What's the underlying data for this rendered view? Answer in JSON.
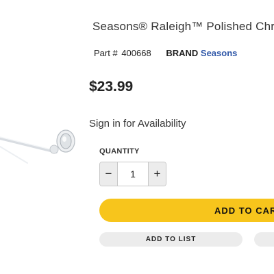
{
  "product": {
    "title": "Seasons® Raleigh™ Polished Chr",
    "part_label": "Part #",
    "part_number": "400668",
    "brand_label": "BRAND",
    "brand_name": "Seasons",
    "price": "$23.99",
    "availability": "Sign in for Availability"
  },
  "quantity": {
    "label": "QUANTITY",
    "decrement": "−",
    "increment": "+",
    "value": "1"
  },
  "actions": {
    "add_to_cart": "ADD TO CAR",
    "add_to_list": "ADD TO LIST"
  },
  "colors": {
    "accent_yellow": "#f7c51c",
    "brand_link": "#2f57a8",
    "pill_gray": "#ececec"
  },
  "icons": {
    "product": "towel-bar-image"
  }
}
